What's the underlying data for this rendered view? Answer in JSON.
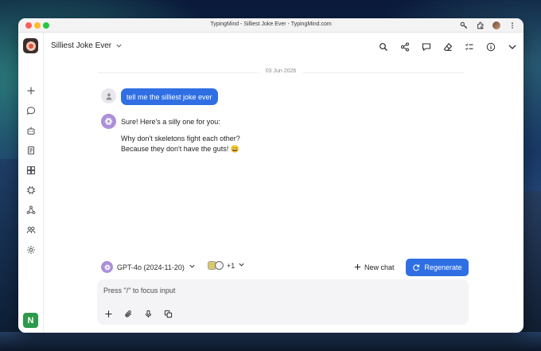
{
  "window": {
    "title": "TypingMind - Silliest Joke Ever - TypingMind.com"
  },
  "titlebar_icons": [
    "key-icon",
    "extension-icon",
    "profile-avatar",
    "more-vertical-icon"
  ],
  "sidebar": {
    "items": [
      {
        "icon": "plus-icon",
        "name": "new-chat"
      },
      {
        "icon": "chat-bubble-icon",
        "name": "chats"
      },
      {
        "icon": "agents-icon",
        "name": "agents"
      },
      {
        "icon": "prompts-icon",
        "name": "prompts"
      },
      {
        "icon": "plugins-icon",
        "name": "plugins"
      },
      {
        "icon": "models-icon",
        "name": "models"
      },
      {
        "icon": "share-nodes-icon",
        "name": "share"
      },
      {
        "icon": "team-icon",
        "name": "team"
      },
      {
        "icon": "settings-icon",
        "name": "settings"
      }
    ],
    "badge_label": "N"
  },
  "header": {
    "chat_title": "Silliest Joke Ever",
    "icons": [
      "search-icon",
      "share-icon",
      "chat-edit-icon",
      "eraser-icon",
      "checklist-icon",
      "info-icon",
      "chevron-down-icon"
    ]
  },
  "conversation": {
    "date": "03 Jun 2026",
    "user_message": "tell me the silliest joke ever",
    "ai_lines": [
      "Sure! Here's a silly one for you:",
      "Why don't skeletons fight each other?",
      "Because they don't have the guts! 😄"
    ]
  },
  "composer": {
    "model_label": "GPT-4o (2024-11-20)",
    "plugins_extra_count": "+1",
    "new_chat_label": "New chat",
    "regenerate_label": "Regenerate",
    "input_placeholder": "Press \"/\" to focus input",
    "input_value": "",
    "tools": [
      "plus-icon",
      "attachment-icon",
      "microphone-icon",
      "copy-icon"
    ]
  },
  "colors": {
    "accent": "#2f6fe3",
    "model_purple": "#ad8fd9",
    "badge_green": "#2c9a4a"
  }
}
